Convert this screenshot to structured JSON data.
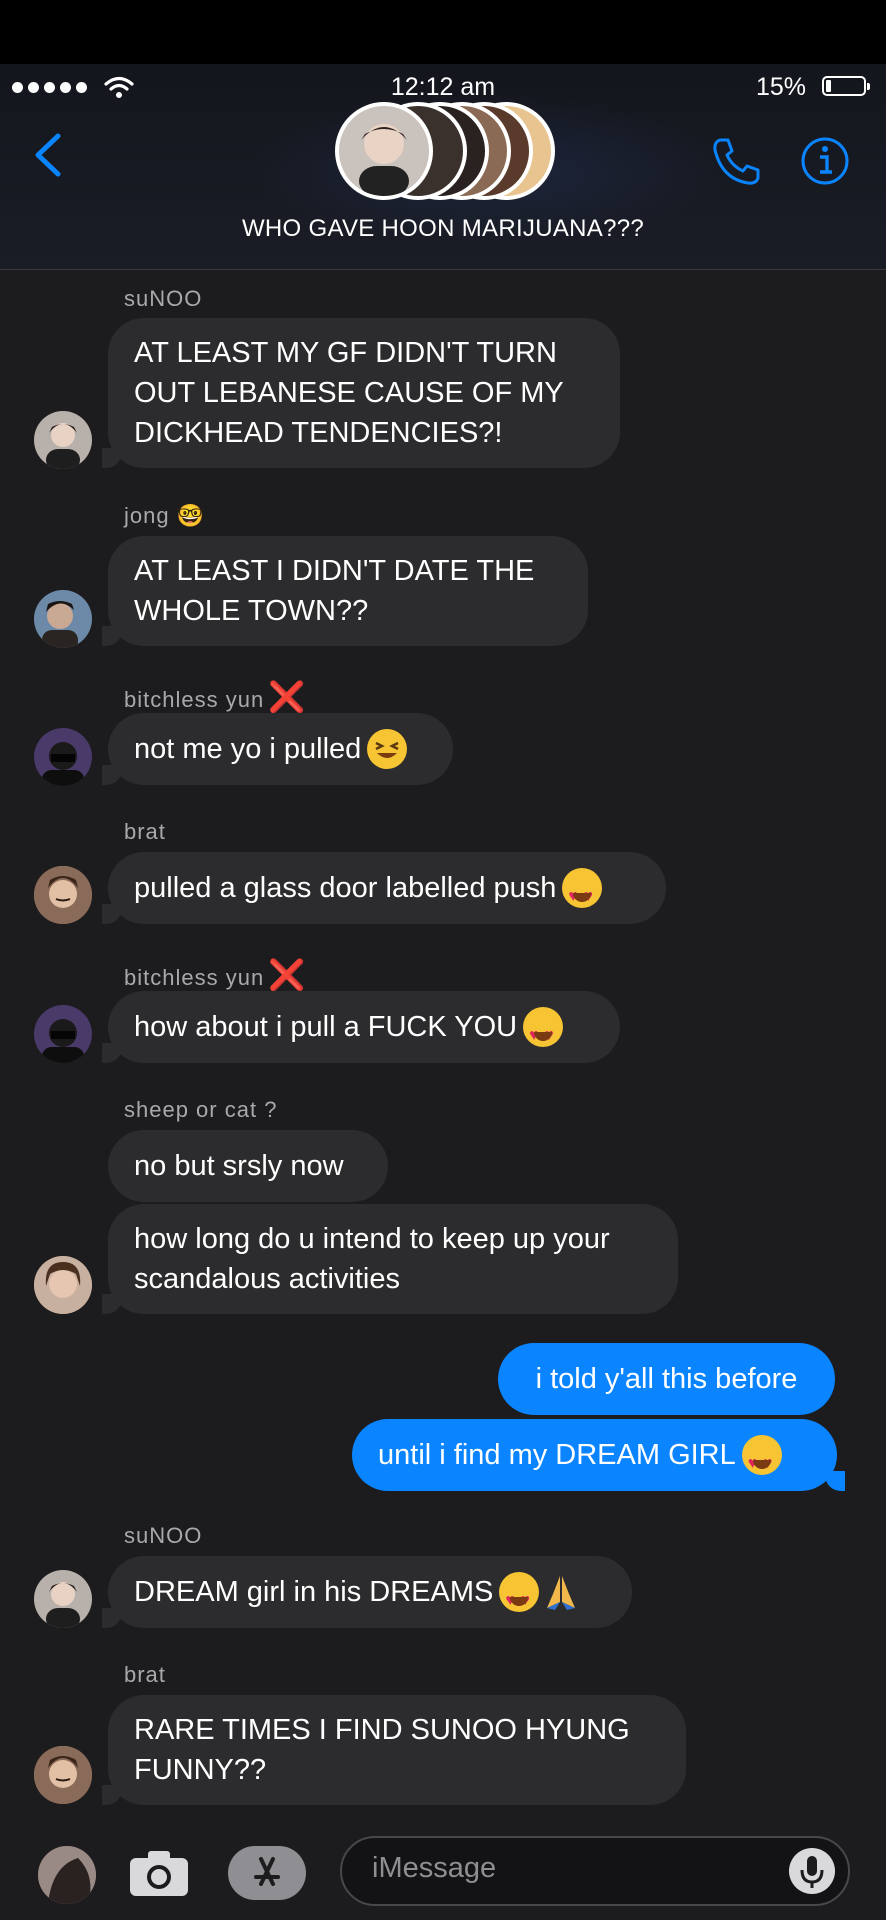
{
  "status_bar": {
    "time": "12:12 am",
    "battery": "15%"
  },
  "header": {
    "group_name": "WHO GAVE HOON MARIJUANA???"
  },
  "messages": [
    {
      "sender": "suNOO",
      "text": "AT LEAST MY GF DIDN'T TURN\nOUT LEBANESE CAUSE OF MY\nDICKHEAD TENDENCIES?!"
    },
    {
      "sender": "jong 🤓",
      "text": "AT LEAST I DIDN'T DATE THE\nWHOLE TOWN??"
    },
    {
      "sender": "bitchless yun",
      "sender_mark": "❌",
      "text": "not me yo i pulled",
      "emoji": "laughing-face"
    },
    {
      "sender": "brat",
      "text": "pulled a glass door labelled push",
      "emoji": "heart-eyes"
    },
    {
      "sender": "bitchless yun",
      "sender_mark": "❌",
      "text": "how about i pull a FUCK YOU",
      "emoji": "heart-eyes"
    },
    {
      "sender": "sheep or cat ?",
      "text": "no but srsly now"
    },
    {
      "sender": "sheep or cat ?",
      "text": "how long do u intend to keep up your\nscandalous activities"
    },
    {
      "sender": "me",
      "text": "i told y'all this before"
    },
    {
      "sender": "me",
      "text": "until i find my DREAM GIRL",
      "emoji": "heart-eyes"
    },
    {
      "sender": "suNOO",
      "text": "DREAM girl in his DREAMS",
      "emoji": "heart-eyes folded-hands"
    },
    {
      "sender": "brat",
      "text": "RARE TIMES I FIND SUNOO HYUNG\nFUNNY??"
    }
  ],
  "composer": {
    "placeholder": "iMessage"
  },
  "colors": {
    "bubble_in": "#2c2c2e",
    "bubble_out": "#0a84ff",
    "accent": "#0a84ff",
    "background": "#1c1c1e"
  }
}
